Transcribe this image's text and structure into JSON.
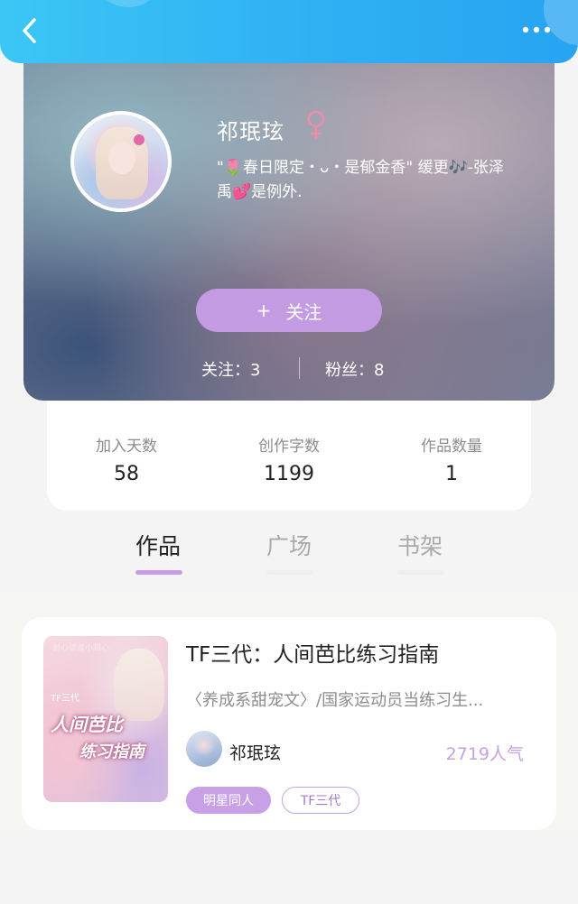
{
  "header": {
    "back_icon": "chevron-left-icon",
    "more_icon": "more-dots-icon"
  },
  "profile": {
    "name": "祁珉玹",
    "gender_icon": "female-icon",
    "gender_color": "#f08cab",
    "bio": "\"🌷春日限定・ᴗ・是郁金香\" 缓更🎶-张泽禹💕是例外.",
    "follow_button": {
      "plus": "+",
      "label": "关注"
    },
    "following": "关注：3",
    "fans": "粉丝：8"
  },
  "stats": [
    {
      "label": "加入天数",
      "value": "58"
    },
    {
      "label": "创作字数",
      "value": "1199"
    },
    {
      "label": "作品数量",
      "value": "1"
    }
  ],
  "tabs": [
    {
      "label": "作品",
      "active": true
    },
    {
      "label": "广场",
      "active": false
    },
    {
      "label": "书架",
      "active": false
    }
  ],
  "works": [
    {
      "cover_text": {
        "top": "耐心读者小甜心",
        "small": "TF三代",
        "line1": "人间芭比",
        "line2": "练习指南"
      },
      "title": "TF三代：人间芭比练习指南",
      "description": "〈养成系甜宠文〉/国家运动员当练习生...",
      "author": "祁珉玹",
      "popularity": "2719人气",
      "tags": [
        "明星同人",
        "TF三代"
      ]
    }
  ],
  "colors": {
    "header_gradient_start": "#3cc6f5",
    "header_gradient_end": "#27a4f2",
    "accent_purple": "#c39be3",
    "popularity_purple": "#c7a2e3"
  }
}
